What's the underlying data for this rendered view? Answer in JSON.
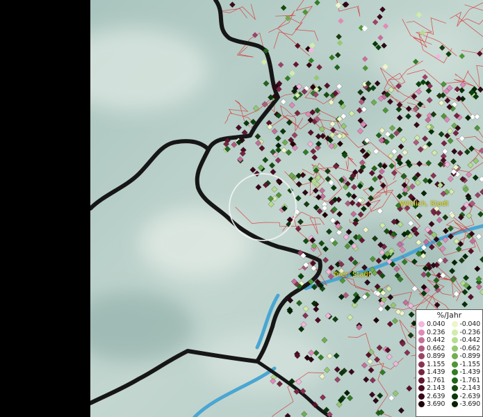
{
  "map": {
    "places": [
      {
        "name": "Wittlich, Stadt"
      },
      {
        "name": "Trier, Stadt"
      }
    ]
  },
  "legend": {
    "title": "%/Jahr",
    "positive": [
      {
        "label": "0.040",
        "color": "#f3b6dc"
      },
      {
        "label": "0.236",
        "color": "#e08ab8"
      },
      {
        "label": "0.442",
        "color": "#c4709a"
      },
      {
        "label": "0.662",
        "color": "#b05a7e"
      },
      {
        "label": "0.899",
        "color": "#9a4466"
      },
      {
        "label": "1.155",
        "color": "#8a3252"
      },
      {
        "label": "1.439",
        "color": "#782440"
      },
      {
        "label": "1.761",
        "color": "#621632"
      },
      {
        "label": "2.143",
        "color": "#4e0c24"
      },
      {
        "label": "2.639",
        "color": "#380616"
      },
      {
        "label": "3.690",
        "color": "#220208"
      }
    ],
    "negative": [
      {
        "label": "-0.040",
        "color": "#eef5c8"
      },
      {
        "label": "-0.236",
        "color": "#d2ecaa"
      },
      {
        "label": "-0.442",
        "color": "#b6dc8e"
      },
      {
        "label": "-0.662",
        "color": "#96c872"
      },
      {
        "label": "-0.899",
        "color": "#70ae52"
      },
      {
        "label": "-1.155",
        "color": "#4e9638"
      },
      {
        "label": "-1.439",
        "color": "#347c26"
      },
      {
        "label": "-1.761",
        "color": "#22641a"
      },
      {
        "label": "-2.143",
        "color": "#144c10"
      },
      {
        "label": "-2.639",
        "color": "#0a380a"
      },
      {
        "label": "-3.690",
        "color": "#042404"
      }
    ]
  }
}
